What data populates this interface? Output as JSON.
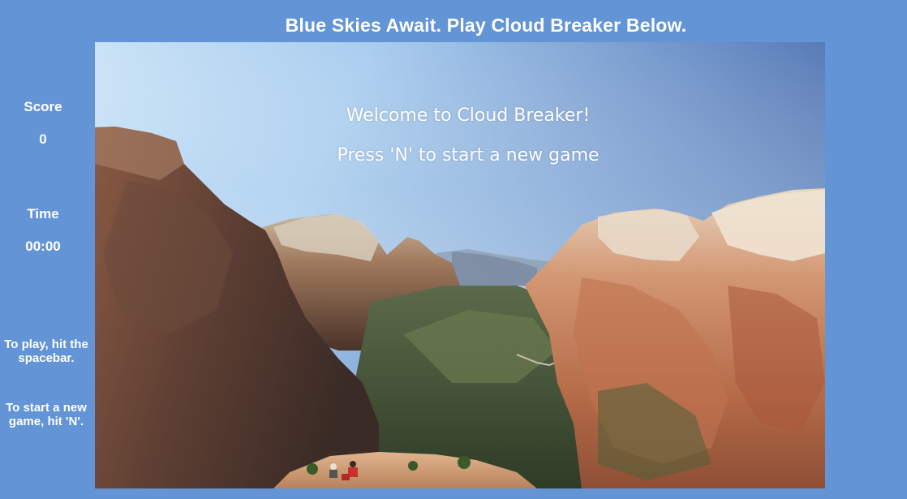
{
  "header": {
    "title": "Blue Skies Await. Play Cloud Breaker Below."
  },
  "sidebar": {
    "score_label": "Score",
    "score_value": "0",
    "time_label": "Time",
    "time_value": "00:00",
    "help_play": "To play, hit the spacebar.",
    "help_new_game": "To start a new game, hit 'N'."
  },
  "game": {
    "welcome_text": "Welcome to Cloud Breaker!",
    "start_prompt": "Press 'N' to start a new game",
    "background_scene": "canyon-landscape-photo"
  },
  "colors": {
    "page_background": "#6394d6",
    "text": "#ffffff"
  }
}
